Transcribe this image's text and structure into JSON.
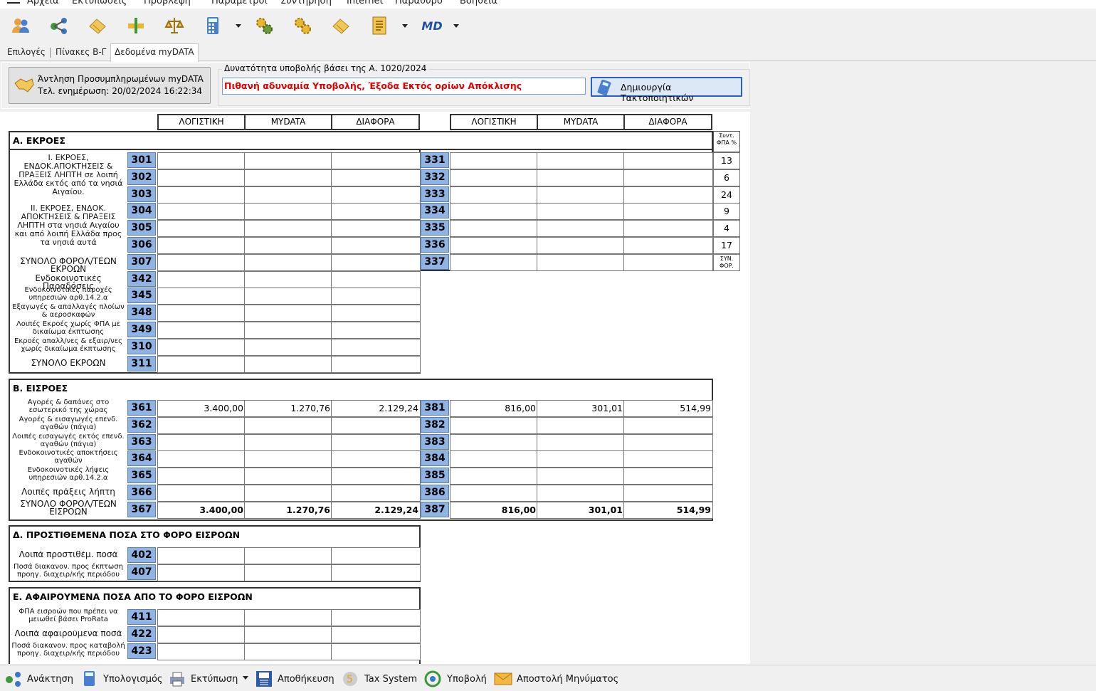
{
  "menu": [
    "Αρχεία",
    "Εκτυπώσεις",
    "Πρόβλεψη",
    "Παράμετροι",
    "Συντήρηση",
    "Internet",
    "Παράθυρο",
    "Βοήθεια"
  ],
  "toolbar": {
    "icons": [
      "users-icon",
      "share-icon",
      "eraser-icon",
      "pin-icon",
      "scales-icon",
      "calculator-icon",
      "gears-icon",
      "gears-icon",
      "eraser-icon",
      "document-icon"
    ],
    "md_label": "MD"
  },
  "tabs": [
    "Επιλογές",
    "Πίνακες Β-Γ",
    "Δεδομένα myDATA"
  ],
  "fetch": {
    "line1": "Άντληση Προσυμπληρωμένων myDATA",
    "line2": "Τελ. ενημέρωση: 20/02/2024 16:22:34"
  },
  "group": {
    "title": "Δυνατότητα υποβολής βάσει της Α. 1020/2024",
    "warning": "Πιθανή αδυναμία Υποβολής, Έξοδα Εκτός ορίων Απόκλισης",
    "create_label": "Δημιουργία Τακτοποιητικών"
  },
  "headers": {
    "col1": "ΛΟΓΙΣΤΙΚΗ",
    "col2": "MYDATA",
    "col3": "ΔΙΑΦΟΡΑ",
    "rate": "Συντ. ΦΠΑ %",
    "rate_total": "ΣΥΝ. ΦΟΡ."
  },
  "sectionA": {
    "title": "Α. ΕΚΡΟΕΣ",
    "group1": "Ι. ΕΚΡΟΕΣ, ΕΝΔΟΚ.ΑΠΟΚΤΗΣΕΙΣ & ΠΡΑΞΕΙΣ ΛΗΠΤΗ σε λοιπή Ελλάδα εκτός από τα νησιά Αιγαίου.",
    "group2": "ΙΙ. ΕΚΡΟΕΣ, ΕΝΔΟΚ. ΑΠΟΚΤΗΣΕΙΣ & ΠΡΑΞΕΙΣ ΛΗΠΤΗ στα νησιά Αιγαίου και από λοιπή Ελλάδα προς τα νησιά αυτά",
    "rows": [
      {
        "code": "301",
        "code2": "331",
        "rate": "13"
      },
      {
        "code": "302",
        "code2": "332",
        "rate": "6"
      },
      {
        "code": "303",
        "code2": "333",
        "rate": "24"
      },
      {
        "code": "304",
        "code2": "334",
        "rate": "9"
      },
      {
        "code": "305",
        "code2": "335",
        "rate": "4"
      },
      {
        "code": "306",
        "code2": "336",
        "rate": "17"
      },
      {
        "label": "ΣΥΝΟΛΟ ΦΟΡΟΛ/ΤΕΩΝ ΕΚΡΟΩΝ",
        "code": "307",
        "code2": "337"
      },
      {
        "label": "Ενδοκοινοτικές Παραδόσεις",
        "code": "342"
      },
      {
        "label": "Ενδοκοινοτικές παροχές υπηρεσιών αρθ.14.2.α",
        "code": "345"
      },
      {
        "label": "Εξαγωγές & απαλλαγές πλοίων & αεροσκαφών",
        "code": "348"
      },
      {
        "label": "Λοιπές Εκροές χωρίς ΦΠΑ με δικαίωμα έκπτωσης",
        "code": "349"
      },
      {
        "label": "Εκροές απαλλ/νες & εξαιρ/νες χωρίς δικαίωμα έκπτωσης",
        "code": "310"
      },
      {
        "label": "ΣΥΝΟΛΟ ΕΚΡΟΩΝ",
        "code": "311"
      }
    ]
  },
  "sectionB": {
    "title": "Β. ΕΙΣΡΟΕΣ",
    "rows": [
      {
        "label": "Αγορές & δαπάνες στο εσωτερικό της χώρας",
        "code": "361",
        "v1": "3.400,00",
        "v2": "1.270,76",
        "v3": "2.129,24",
        "code2": "381",
        "w1": "816,00",
        "w2": "301,01",
        "w3": "514,99"
      },
      {
        "label": "Αγορές & εισαγωγές επενδ. αγαθών (πάγια)",
        "code": "362",
        "code2": "382"
      },
      {
        "label": "Λοιπές εισαγωγές εκτός επενδ. αγαθών (πάγια)",
        "code": "363",
        "code2": "383"
      },
      {
        "label": "Ενδοκοινοτικές αποκτήσεις αγαθών",
        "code": "364",
        "code2": "384"
      },
      {
        "label": "Ενδοκοινοτικές λήψεις υπηρεσιών αρθ.14.2.α",
        "code": "365",
        "code2": "385"
      },
      {
        "label": "Λοιπές πράξεις λήπτη",
        "code": "366",
        "code2": "386"
      },
      {
        "label": "ΣΥΝΟΛΟ ΦΟΡΟΛ/ΤΕΩΝ ΕΙΣΡΟΩΝ",
        "code": "367",
        "v1": "3.400,00",
        "v2": "1.270,76",
        "v3": "2.129,24",
        "code2": "387",
        "w1": "816,00",
        "w2": "301,01",
        "w3": "514,99"
      }
    ]
  },
  "sectionD": {
    "title": "Δ. ΠΡΟΣΤΙΘΕΜΕΝΑ ΠΟΣΑ ΣΤΟ ΦΟΡΟ ΕΙΣΡΟΩΝ",
    "rows": [
      {
        "label": "Λοιπά προστιθέμ. ποσά",
        "code": "402"
      },
      {
        "label": "Ποσά διακανον. προς έκπτωση προηγ. διαχειρ/κής περιόδου",
        "code": "407"
      }
    ]
  },
  "sectionE": {
    "title": "Ε. ΑΦΑΙΡΟΥΜΕΝΑ ΠΟΣΑ ΑΠΟ ΤΟ ΦΟΡΟ ΕΙΣΡΟΩΝ",
    "rows": [
      {
        "label": "ΦΠΑ εισροών που πρέπει να μειωθεί βάσει ProRata",
        "code": "411"
      },
      {
        "label": "Λοιπά αφαιρούμενα ποσά",
        "code": "422"
      },
      {
        "label": "Ποσά διακανον. προς καταβολή προηγ. διαχειρ/κής περιόδου",
        "code": "423"
      }
    ]
  },
  "bottom": [
    "Ανάκτηση",
    "Υπολογισμός",
    "Εκτύπωση",
    "Αποθήκευση",
    "Tax System",
    "Υποβολή",
    "Αποστολή Μηνύματος"
  ],
  "colors": {
    "code_bg": "#8fb4e3",
    "warning": "#e00000",
    "button_border": "#2a5fc4"
  }
}
